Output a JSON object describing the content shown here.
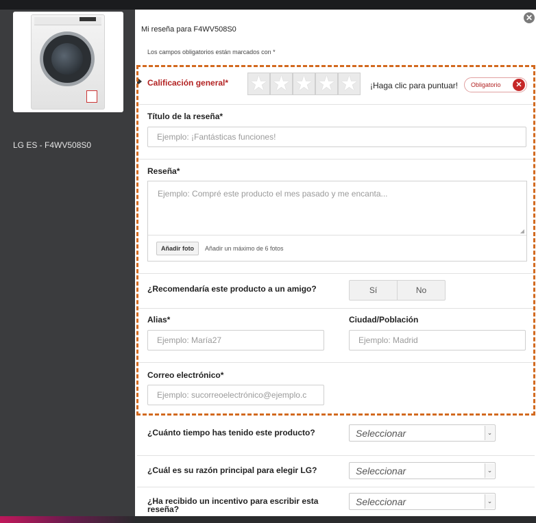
{
  "sidebar": {
    "product_name": "LG ES - F4WV508S0"
  },
  "form": {
    "title": "Mi reseña para F4WV508S0",
    "required_note": "Los campos obligatorios están marcados con *",
    "rating": {
      "label": "Calificación general*",
      "hint": "¡Haga clic para puntuar!",
      "required_label": "Obligatorio",
      "stars": 5,
      "value": 0
    },
    "review_title": {
      "label": "Título de la reseña*",
      "placeholder": "Ejemplo: ¡Fantásticas funciones!"
    },
    "review": {
      "label": "Reseña*",
      "placeholder": "Ejemplo: Compré este producto el mes pasado y me encanta...",
      "add_photo": "Añadir foto",
      "photo_note": "Añadir un máximo de 6 fotos"
    },
    "recommend": {
      "label": "¿Recomendaría este producto a un amigo?",
      "yes": "Sí",
      "no": "No"
    },
    "alias": {
      "label": "Alias*",
      "placeholder": "Ejemplo: María27"
    },
    "city": {
      "label": "Ciudad/Población",
      "placeholder": "Ejemplo: Madrid"
    },
    "email": {
      "label": "Correo electrónico*",
      "placeholder": "Ejemplo: sucorreoelectrónico@ejemplo.c"
    },
    "questions": [
      {
        "label": "¿Cuánto tiempo has tenido este producto?",
        "value": "Seleccionar"
      },
      {
        "label": "¿Cuál es su razón principal para elegir LG?",
        "value": "Seleccionar"
      },
      {
        "label": "¿Ha recibido un incentivo para escribir esta reseña?",
        "value": "Seleccionar"
      }
    ]
  },
  "colors": {
    "accent_dashed": "#d2691e",
    "required_red": "#b22222",
    "sidebar": "#3b3c3e"
  },
  "icons": {
    "close": "close-icon",
    "star": "star-icon",
    "required_x": "x-circle-icon",
    "select_arrow": "chevron-down-icon"
  }
}
